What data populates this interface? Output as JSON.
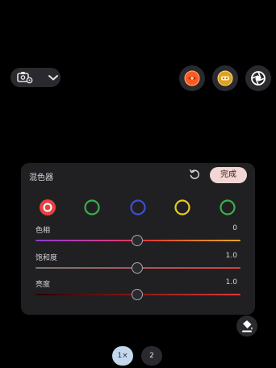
{
  "top_controls": {
    "mode_icon": "camera-settings-icon",
    "chevron_icon": "chevron-down-icon",
    "buttons": [
      {
        "name": "filter-warm-icon",
        "color": "#ff5a1f"
      },
      {
        "name": "filter-gold-icon",
        "color": "#e0a020"
      },
      {
        "name": "aperture-icon",
        "color": "#ffffff"
      }
    ]
  },
  "mixer": {
    "title": "混色器",
    "reset_icon": "reset-icon",
    "done_label": "完成",
    "selected_color": "red",
    "swatches": [
      {
        "name": "red",
        "color": "#e84040"
      },
      {
        "name": "green",
        "color": "#3bb04a"
      },
      {
        "name": "blue",
        "color": "#3d4fd8"
      },
      {
        "name": "yellow",
        "color": "#e8cc1c"
      },
      {
        "name": "green",
        "color": "#3bb04a"
      }
    ],
    "sliders": [
      {
        "label": "色相",
        "value": "0"
      },
      {
        "label": "饱和度",
        "value": "1.0"
      },
      {
        "label": "亮度",
        "value": "1.0"
      }
    ]
  },
  "paint_icon": "paint-bucket-icon",
  "zoom": {
    "options": [
      "1×",
      "2"
    ],
    "selected": "1×"
  }
}
